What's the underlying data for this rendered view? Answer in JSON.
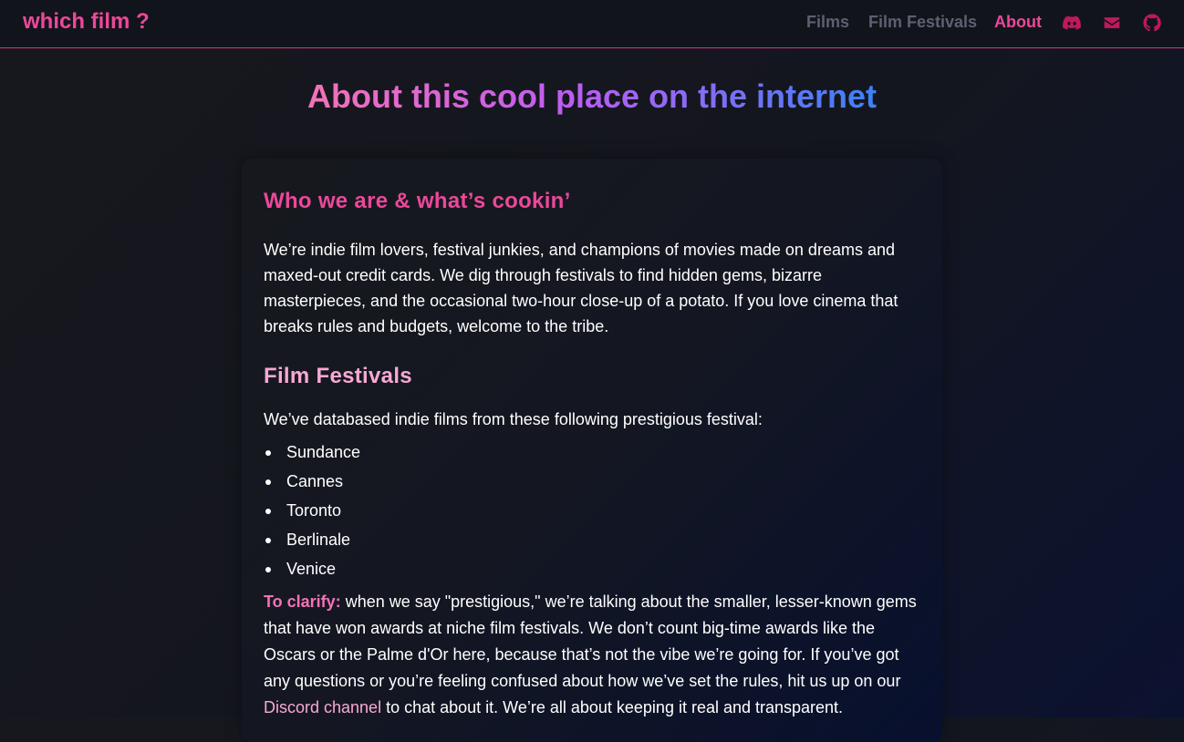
{
  "nav": {
    "brand": "which film ?",
    "links": [
      "Films",
      "Film Festivals",
      "About"
    ],
    "icons": [
      "discord-icon",
      "envelope-icon",
      "github-icon"
    ],
    "accent_color": "#ec4899"
  },
  "hero": {
    "title": "About this cool place on the internet"
  },
  "about": {
    "heading": "Who we are & what’s cookin’",
    "text": "We’re indie film lovers, festival junkies, and champions of movies made on dreams and maxed-out credit cards. We dig through festivals to find hidden gems, bizarre masterpieces, and the occasional two-hour close-up of a potato. If you love cinema that breaks rules and budgets, welcome to the tribe."
  },
  "festivals": {
    "heading": "Film Festivals",
    "intro": "We’ve databased indie films from these following prestigious festival:",
    "items": [
      "Sundance",
      "Cannes",
      "Toronto",
      "Berlinale",
      "Venice"
    ],
    "clarify_label": "To clarify:",
    "clarify_text": " when we say \"prestigious,\" we’re talking about the smaller, lesser-known gems that have won awards at niche film festivals. We don’t count big-time awards like the Oscars or the Palme d'Or here, because that’s not the vibe we’re going for. If you’ve got any questions or you’re feeling confused about how we’ve set the rules, hit us up on our ",
    "discord_link": "Discord channel",
    "clarify_end": " to chat about it. We’re all about keeping it real and transparent."
  }
}
